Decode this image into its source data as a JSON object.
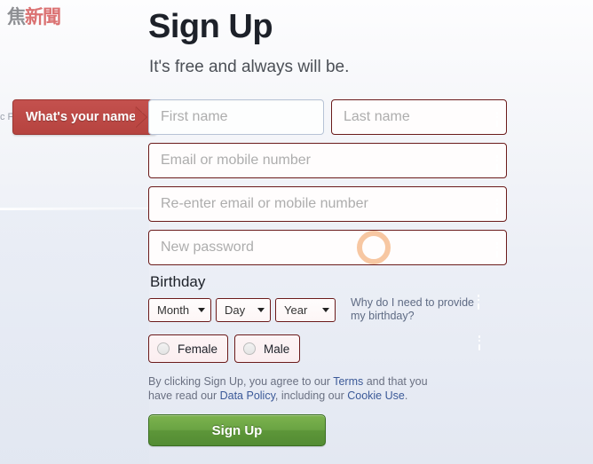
{
  "site": {
    "logo_text": "新聞",
    "logo_mark": "焦",
    "background_ghost_text": "c Fa"
  },
  "header": {
    "title": "Sign Up",
    "subtitle": "It's free and always will be."
  },
  "tooltip": {
    "text": "What's your name?",
    "color": "#bc4743"
  },
  "form": {
    "first_name": {
      "placeholder": "First name",
      "state": "focus"
    },
    "last_name": {
      "placeholder": "Last name",
      "state": "error"
    },
    "email": {
      "placeholder": "Email or mobile number",
      "state": "error"
    },
    "email_confirm": {
      "placeholder": "Re-enter email or mobile number",
      "state": "error"
    },
    "password": {
      "placeholder": "New password",
      "state": "error"
    },
    "birthday": {
      "label": "Birthday",
      "month": "Month",
      "day": "Day",
      "year": "Year",
      "help_line1": "Why do I need to provide",
      "help_line2": "my birthday?"
    },
    "gender": {
      "female": "Female",
      "male": "Male"
    },
    "legal": {
      "part1": "By clicking Sign Up, you agree to our ",
      "terms": "Terms",
      "part2": " and that you have read our ",
      "data_policy": "Data Policy",
      "part3": ", including our ",
      "cookie_use": "Cookie Use",
      "part4": "."
    },
    "submit_label": "Sign Up"
  },
  "colors": {
    "error": "#a82e2b",
    "link": "#3b5998",
    "button_green": "#6aa343",
    "cursor_ring": "#f2a76a"
  }
}
